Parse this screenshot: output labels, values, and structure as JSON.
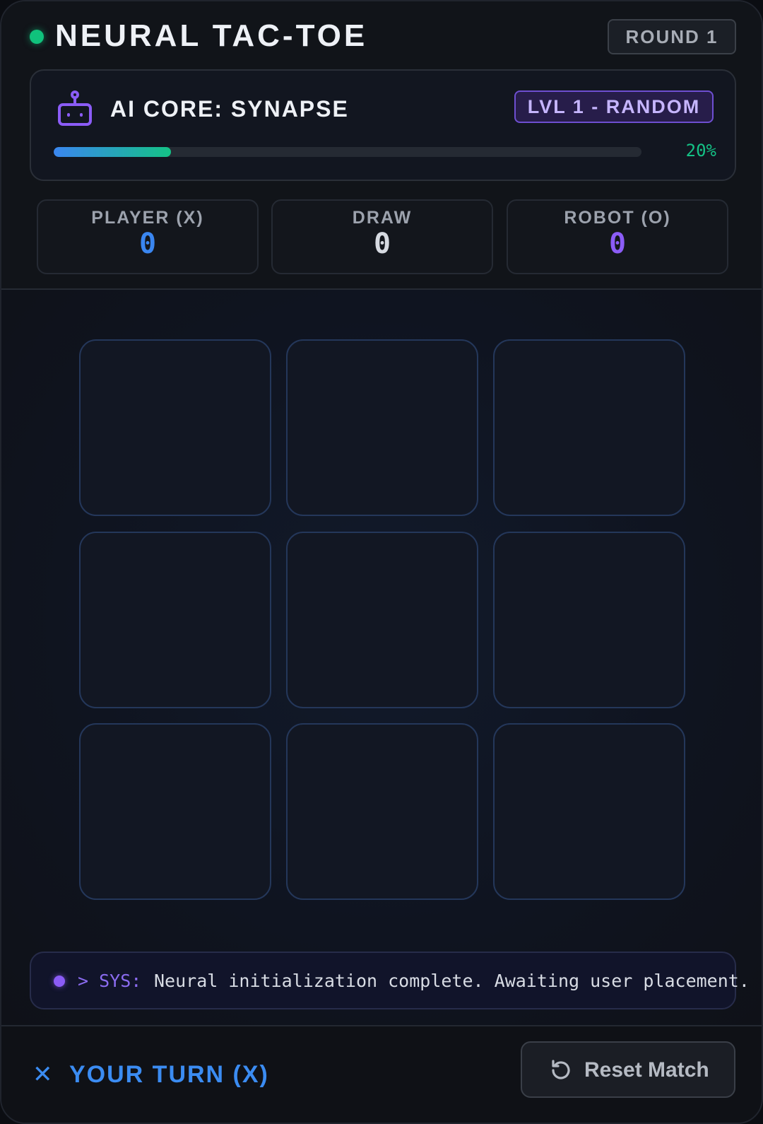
{
  "header": {
    "title": "NEURAL TAC-TOE",
    "round": "ROUND 1",
    "status_color": "#10c27c"
  },
  "ai_core": {
    "name": "AI CORE: SYNAPSE",
    "icon": "robot-icon",
    "level_badge": "LVL 1 - RANDOM",
    "progress": 0.2,
    "progress_text": "20%"
  },
  "scores": [
    {
      "label": "PLAYER (X)",
      "value": "0",
      "color": "#3a86f0"
    },
    {
      "label": "DRAW",
      "value": "0",
      "color": "#d6dae1"
    },
    {
      "label": "ROBOT (O)",
      "value": "0",
      "color": "#8b5cf6"
    }
  ],
  "board": {
    "cells": [
      "",
      "",
      "",
      "",
      "",
      "",
      "",
      "",
      ""
    ]
  },
  "log": {
    "prefix": "> SYS:",
    "message": "Neural initialization complete. Awaiting user placement."
  },
  "footer": {
    "turn_symbol": "✕",
    "turn_text": "YOUR TURN (X)",
    "reset_label": "Reset Match",
    "reset_icon": "reset-icon"
  }
}
